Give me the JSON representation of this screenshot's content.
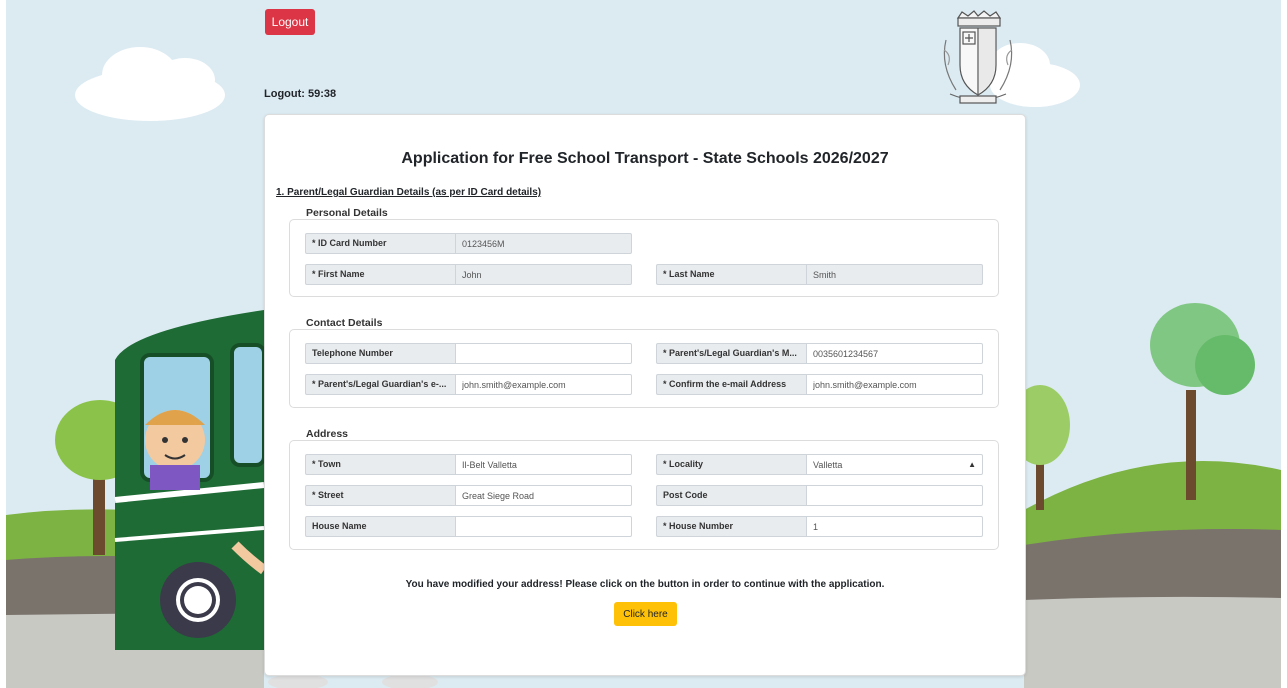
{
  "header": {
    "logout_label": "Logout",
    "timer_text": "Logout: 59:38"
  },
  "form": {
    "title": "Application for Free School Transport - State Schools 2026/2027",
    "section_heading": "1. Parent/Legal Guardian Details (as per ID Card details)",
    "personal": {
      "title": "Personal Details",
      "id_card_label": "* ID Card Number",
      "id_card_value": "0123456M",
      "first_name_label": "* First Name",
      "first_name_value": "John",
      "last_name_label": "* Last Name",
      "last_name_value": "Smith"
    },
    "contact": {
      "title": "Contact Details",
      "telephone_label": "Telephone Number",
      "telephone_value": "",
      "mobile_label": "* Parent's/Legal Guardian's M...",
      "mobile_value": "0035601234567",
      "email_label": "* Parent's/Legal Guardian's e-...",
      "email_value": "john.smith@example.com",
      "confirm_email_label": "* Confirm the e-mail Address",
      "confirm_email_value": "john.smith@example.com"
    },
    "address": {
      "title": "Address",
      "town_label": "* Town",
      "town_value": "Il-Belt Valletta",
      "locality_label": "* Locality",
      "locality_value": "Valletta",
      "street_label": "* Street",
      "street_value": "Great Siege Road",
      "postcode_label": "Post Code",
      "postcode_value": "",
      "house_name_label": "House Name",
      "house_name_value": "",
      "house_number_label": "* House Number",
      "house_number_value": "1"
    },
    "notice": "You have modified your address! Please click on the button in order to continue with the application.",
    "continue_label": "Click here"
  },
  "colors": {
    "logout": "#dc3545",
    "continue": "#ffc107",
    "sky": "#dcebf2",
    "bus": "#1f6b35"
  },
  "icons": {
    "crest": "malta-coat-of-arms-icon",
    "select_caret": "updown-caret-icon"
  }
}
